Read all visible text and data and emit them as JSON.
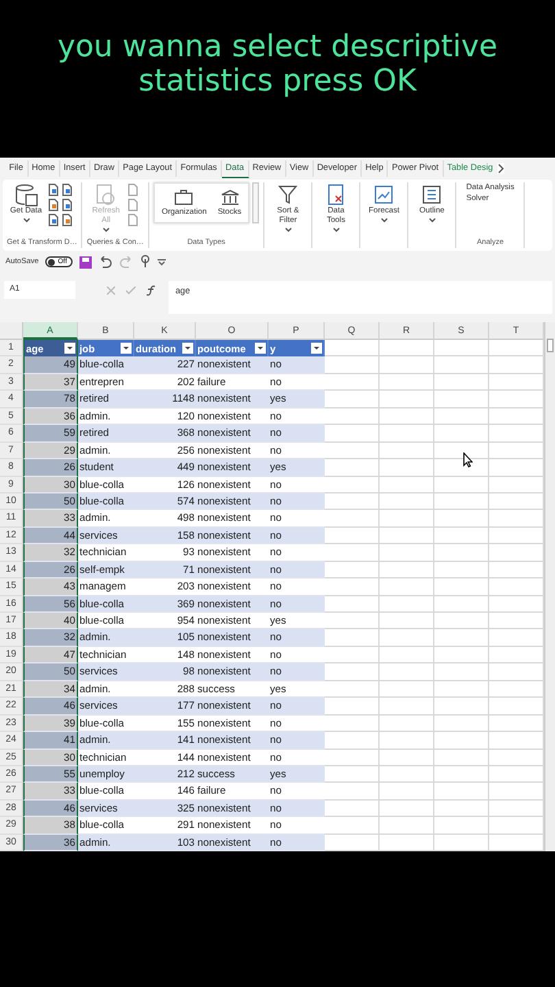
{
  "caption": {
    "lines": [
      "you wanna select descriptive",
      "statistics press OK"
    ]
  },
  "ribbon": {
    "tabs": [
      {
        "label": "File",
        "selected": false,
        "kind": "standard"
      },
      {
        "label": "Home",
        "selected": false,
        "kind": "standard"
      },
      {
        "label": "Insert",
        "selected": false,
        "kind": "standard"
      },
      {
        "label": "Draw",
        "selected": false,
        "kind": "standard"
      },
      {
        "label": "Page Layout",
        "selected": false,
        "kind": "standard"
      },
      {
        "label": "Formulas",
        "selected": false,
        "kind": "standard"
      },
      {
        "label": "Data",
        "selected": true,
        "kind": "standard"
      },
      {
        "label": "Review",
        "selected": false,
        "kind": "standard"
      },
      {
        "label": "View",
        "selected": false,
        "kind": "standard"
      },
      {
        "label": "Developer",
        "selected": false,
        "kind": "standard"
      },
      {
        "label": "Help",
        "selected": false,
        "kind": "standard"
      },
      {
        "label": "Power Pivot",
        "selected": false,
        "kind": "standard"
      },
      {
        "label": "Table Desig",
        "selected": false,
        "kind": "contextual"
      }
    ],
    "groups": [
      {
        "label": "Get & Transform D…",
        "kind": "button",
        "buttons": [
          {
            "label": "Get Data",
            "disabled": false
          }
        ]
      },
      {
        "label": "Queries & Con…",
        "kind": "button",
        "buttons": [
          {
            "label": "Refresh All",
            "disabled": true
          }
        ]
      },
      {
        "label": "Data Types",
        "kind": "gallery",
        "items": [
          "Organization",
          "Stocks"
        ]
      },
      {
        "kind": "button",
        "buttons": [
          {
            "label": "Sort & Filter",
            "disabled": false
          }
        ]
      },
      {
        "kind": "button",
        "buttons": [
          {
            "label": "Data Tools",
            "disabled": false
          }
        ]
      },
      {
        "kind": "button",
        "buttons": [
          {
            "label": "Forecast",
            "disabled": false
          }
        ]
      },
      {
        "kind": "button",
        "buttons": [
          {
            "label": "Outline",
            "disabled": false
          }
        ]
      },
      {
        "label": "Analyze",
        "kind": "links",
        "items": [
          "Data Analysis",
          "Solver"
        ]
      }
    ]
  },
  "quick_access": {
    "autosave_label": "AutoSave",
    "autosave": {
      "on": false,
      "label": "Off"
    }
  },
  "formula_bar": {
    "name_box": "A1",
    "value": "age"
  },
  "sheet": {
    "columns": [
      {
        "letter": "A",
        "selected": true
      },
      {
        "letter": "B",
        "selected": false
      },
      {
        "letter": "K",
        "selected": false
      },
      {
        "letter": "O",
        "selected": false
      },
      {
        "letter": "P",
        "selected": false
      },
      {
        "letter": "Q",
        "selected": false
      },
      {
        "letter": "R",
        "selected": false
      },
      {
        "letter": "S",
        "selected": false
      },
      {
        "letter": "T",
        "selected": false
      }
    ],
    "header": {
      "num": "1",
      "cells": [
        "age",
        "job",
        "duration",
        "poutcome",
        "y"
      ]
    },
    "rows": [
      {
        "num": "2",
        "cells": [
          "49",
          "blue-colla",
          "227",
          "nonexistent",
          "no"
        ]
      },
      {
        "num": "3",
        "cells": [
          "37",
          "entrepren",
          "202",
          "failure",
          "no"
        ]
      },
      {
        "num": "4",
        "cells": [
          "78",
          "retired",
          "1148",
          "nonexistent",
          "yes"
        ]
      },
      {
        "num": "5",
        "cells": [
          "36",
          "admin.",
          "120",
          "nonexistent",
          "no"
        ]
      },
      {
        "num": "6",
        "cells": [
          "59",
          "retired",
          "368",
          "nonexistent",
          "no"
        ]
      },
      {
        "num": "7",
        "cells": [
          "29",
          "admin.",
          "256",
          "nonexistent",
          "no"
        ]
      },
      {
        "num": "8",
        "cells": [
          "26",
          "student",
          "449",
          "nonexistent",
          "yes"
        ]
      },
      {
        "num": "9",
        "cells": [
          "30",
          "blue-colla",
          "126",
          "nonexistent",
          "no"
        ]
      },
      {
        "num": "10",
        "cells": [
          "50",
          "blue-colla",
          "574",
          "nonexistent",
          "no"
        ]
      },
      {
        "num": "11",
        "cells": [
          "33",
          "admin.",
          "498",
          "nonexistent",
          "no"
        ]
      },
      {
        "num": "12",
        "cells": [
          "44",
          "services",
          "158",
          "nonexistent",
          "no"
        ]
      },
      {
        "num": "13",
        "cells": [
          "32",
          "technician",
          "93",
          "nonexistent",
          "no"
        ]
      },
      {
        "num": "14",
        "cells": [
          "26",
          "self-empk",
          "71",
          "nonexistent",
          "no"
        ]
      },
      {
        "num": "15",
        "cells": [
          "43",
          "managem",
          "203",
          "nonexistent",
          "no"
        ]
      },
      {
        "num": "16",
        "cells": [
          "56",
          "blue-colla",
          "369",
          "nonexistent",
          "no"
        ]
      },
      {
        "num": "17",
        "cells": [
          "40",
          "blue-colla",
          "954",
          "nonexistent",
          "yes"
        ]
      },
      {
        "num": "18",
        "cells": [
          "32",
          "admin.",
          "105",
          "nonexistent",
          "no"
        ]
      },
      {
        "num": "19",
        "cells": [
          "47",
          "technician",
          "148",
          "nonexistent",
          "no"
        ]
      },
      {
        "num": "20",
        "cells": [
          "50",
          "services",
          "98",
          "nonexistent",
          "no"
        ]
      },
      {
        "num": "21",
        "cells": [
          "34",
          "admin.",
          "288",
          "success",
          "yes"
        ]
      },
      {
        "num": "22",
        "cells": [
          "46",
          "services",
          "177",
          "nonexistent",
          "no"
        ]
      },
      {
        "num": "23",
        "cells": [
          "39",
          "blue-colla",
          "155",
          "nonexistent",
          "no"
        ]
      },
      {
        "num": "24",
        "cells": [
          "41",
          "admin.",
          "141",
          "nonexistent",
          "no"
        ]
      },
      {
        "num": "25",
        "cells": [
          "30",
          "technician",
          "144",
          "nonexistent",
          "no"
        ]
      },
      {
        "num": "26",
        "cells": [
          "55",
          "unemploy",
          "212",
          "success",
          "yes"
        ]
      },
      {
        "num": "27",
        "cells": [
          "33",
          "blue-colla",
          "146",
          "failure",
          "no"
        ]
      },
      {
        "num": "28",
        "cells": [
          "46",
          "services",
          "325",
          "nonexistent",
          "no"
        ]
      },
      {
        "num": "29",
        "cells": [
          "38",
          "blue-colla",
          "291",
          "nonexistent",
          "no"
        ]
      },
      {
        "num": "30",
        "cells": [
          "36",
          "admin.",
          "103",
          "nonexistent",
          "no"
        ]
      }
    ]
  }
}
